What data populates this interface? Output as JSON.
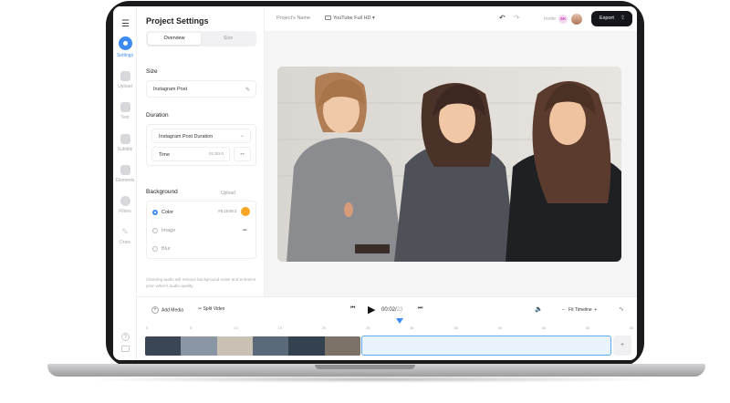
{
  "sidebar": {
    "items": [
      {
        "label": "Settings"
      },
      {
        "label": "Upload"
      },
      {
        "label": "Text"
      },
      {
        "label": "Subtitle"
      },
      {
        "label": "Elements"
      },
      {
        "label": "Filters"
      },
      {
        "label": "Draw"
      }
    ]
  },
  "panel": {
    "title": "Project Settings",
    "tabs": [
      "Overview",
      "Size"
    ],
    "size_heading": "Size",
    "size_value": "Instagram Post",
    "duration_heading": "Duration",
    "duration_select": "Instagram Post Duration",
    "time_label": "Time",
    "time_value": "01:00.0",
    "background_heading": "Background",
    "upload_label": "Upload",
    "options": [
      "Color",
      "Image",
      "Blur"
    ],
    "color_hex": "#E1E0E3",
    "note": "Cleaning audio will remove background noise and enhance your video's audio quality"
  },
  "topbar": {
    "project_name": "Project's Name",
    "resolution": "YouTube Full HD",
    "invite": "Invite",
    "avatar_initials": "SK",
    "export_label": "Export"
  },
  "transport": {
    "add_media": "Add Media",
    "split_video": "Split Video",
    "current_time": "00:02",
    "current_frames": "23",
    "zoom_label": "Fit Timeline"
  },
  "timeline": {
    "ticks": [
      "0",
      "5",
      "10",
      "15",
      "20",
      "25",
      "30",
      "35",
      "40",
      "45",
      "50",
      "55"
    ],
    "playhead_seconds": 25.7
  },
  "colors": {
    "accent": "#3d8bf2",
    "export_bg": "#15161c",
    "swatch": "#f5a623"
  }
}
